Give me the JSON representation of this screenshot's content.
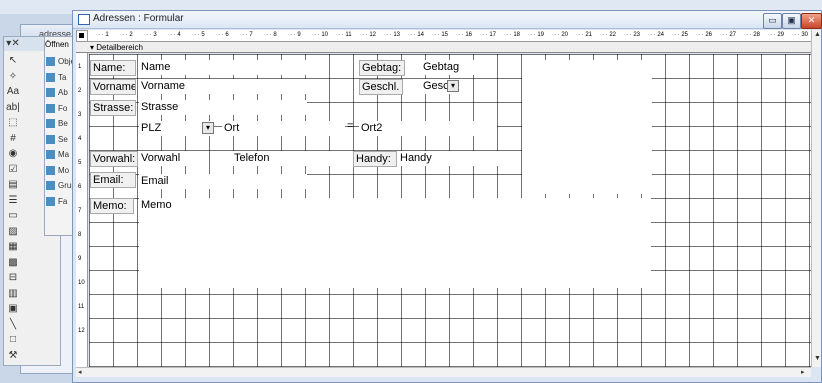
{
  "background": {
    "window_title": "adresse",
    "panel_items": [
      {
        "label": "Objekt",
        "icon": "objects-icon"
      },
      {
        "label": "Ta",
        "icon": "table-icon"
      },
      {
        "label": "Ab",
        "icon": "query-icon"
      },
      {
        "label": "Fo",
        "icon": "form-icon"
      },
      {
        "label": "Be",
        "icon": "report-icon"
      },
      {
        "label": "Se",
        "icon": "page-icon"
      },
      {
        "label": "Ma",
        "icon": "macro-icon"
      },
      {
        "label": "Mo",
        "icon": "module-icon"
      },
      {
        "label": "Grupp",
        "icon": "group-icon"
      },
      {
        "label": "Fa",
        "icon": "favorites-icon"
      }
    ],
    "open_label": "Öffnen"
  },
  "window": {
    "title": "Adressen : Formular",
    "minimize_symbol": "▭",
    "restore_symbol": "▣",
    "close_symbol": "✕"
  },
  "ruler": {
    "h_ticks": [
      "1",
      "2",
      "3",
      "4",
      "5",
      "6",
      "7",
      "8",
      "9",
      "10",
      "11",
      "12",
      "13",
      "14",
      "15",
      "16",
      "17",
      "18",
      "19",
      "20",
      "21",
      "22",
      "23",
      "24",
      "25",
      "26",
      "27",
      "28",
      "29",
      "30"
    ],
    "v_ticks": [
      "1",
      "2",
      "3",
      "4",
      "5",
      "6",
      "7",
      "8",
      "9",
      "10",
      "11",
      "12"
    ]
  },
  "section": {
    "label": "Detailbereich"
  },
  "form": {
    "labels": {
      "name": "Name:",
      "vorname": "Vorname",
      "strasse": "Strasse:",
      "gebtag": "Gebtag:",
      "geschl": "Geschl.",
      "vorwahl": "Vorwahl:",
      "email": "Email:",
      "handy": "Handy:",
      "memo": "Memo:"
    },
    "fields": {
      "name": "Name",
      "vorname": "Vorname",
      "strasse": "Strasse",
      "plz": "PLZ",
      "ort": "Ort",
      "ort2": "Ort2",
      "gebtag": "Gebtag",
      "geschl": "Gesc",
      "vorwahl": "Vorwahl",
      "telefon": "Telefon",
      "handy": "Handy",
      "email": "Email",
      "memo": "Memo"
    },
    "combo_arrow": "▾",
    "separator": "="
  },
  "toolbox": {
    "tools": [
      "pointer-icon",
      "wizard-icon",
      "label-tool-icon",
      "textbox-tool-icon",
      "option-group-icon",
      "toggle-icon",
      "radio-icon",
      "checkbox-icon",
      "combobox-icon",
      "listbox-icon",
      "button-tool-icon",
      "image-icon",
      "unbound-frame-icon",
      "bound-frame-icon",
      "page-break-icon",
      "tab-control-icon",
      "subform-icon",
      "line-icon",
      "rectangle-icon",
      "more-controls-icon"
    ],
    "glyphs": [
      "↖",
      "✧",
      "Aa",
      "ab|",
      "⬚",
      "#",
      "◉",
      "☑",
      "▤",
      "☰",
      "▭",
      "▨",
      "▦",
      "▩",
      "⊟",
      "▥",
      "▣",
      "╲",
      "□",
      "⚒"
    ]
  },
  "colors": {
    "grid_line": "#000000",
    "canvas": "#ffffff",
    "accent": "#2d67b4"
  }
}
